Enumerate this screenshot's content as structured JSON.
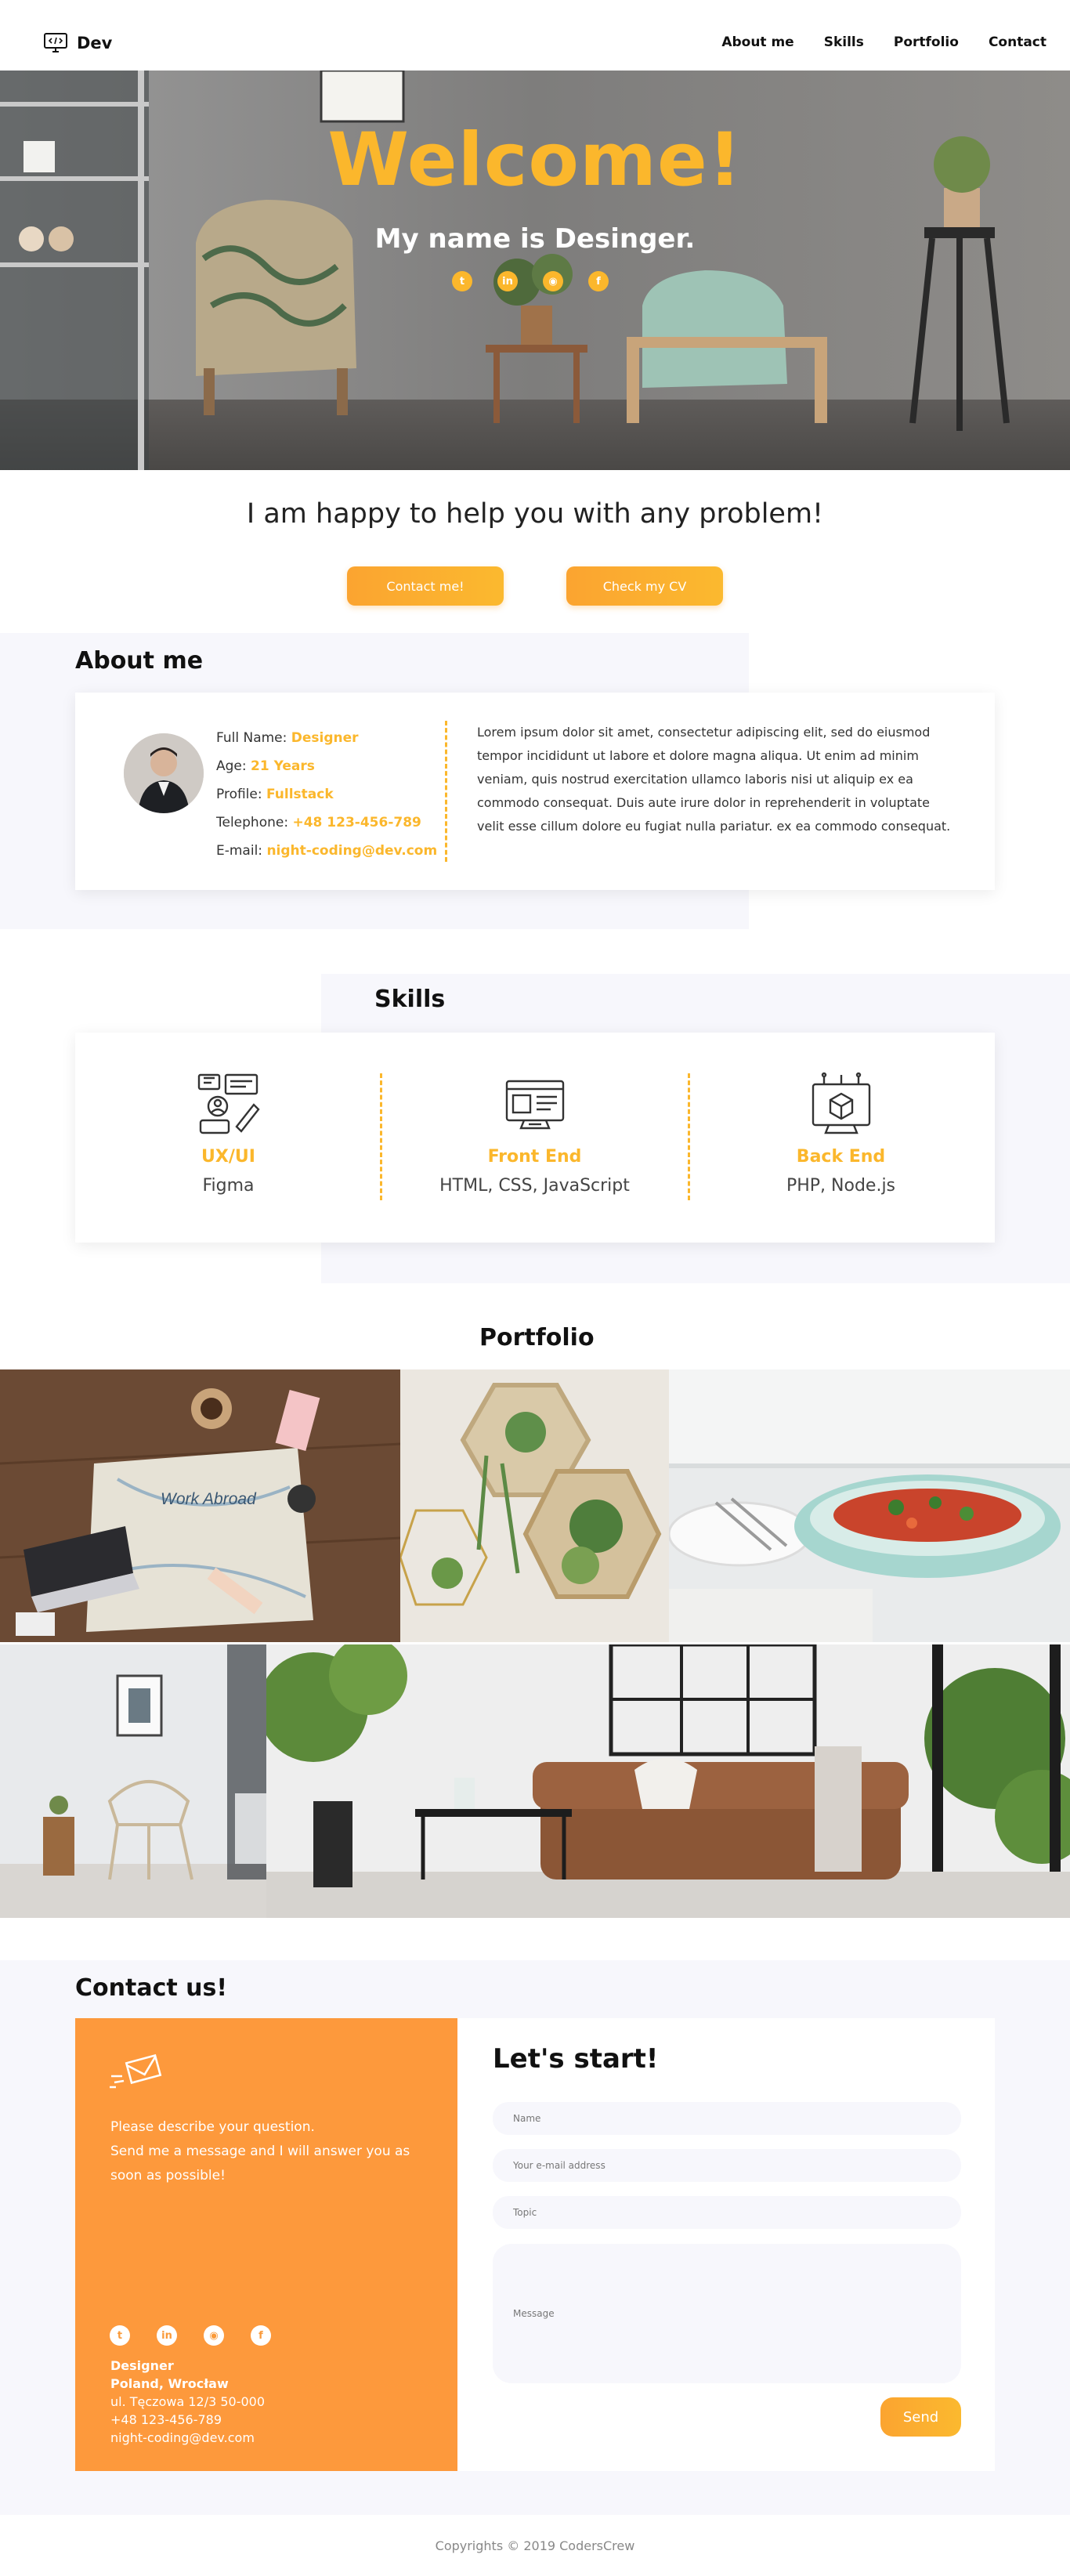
{
  "nav": {
    "logo_text": "Dev",
    "links": [
      "About me",
      "Skills",
      "Portfolio",
      "Contact"
    ]
  },
  "hero": {
    "title": "Welcome!",
    "subtitle": "My name is Desinger.",
    "social_icons": [
      "twitter-icon",
      "linkedin-icon",
      "github-icon",
      "facebook-icon"
    ]
  },
  "intro": {
    "tagline": "I am happy to help you with any problem!",
    "contact_button": "Contact me!",
    "cv_button": "Check my CV"
  },
  "about": {
    "title": "About me",
    "fields": [
      {
        "label": "Full Name: ",
        "value": "Designer"
      },
      {
        "label": "Age: ",
        "value": "21 Years"
      },
      {
        "label": "Profile: ",
        "value": "Fullstack"
      },
      {
        "label": "Telephone: ",
        "value": "+48 123-456-789"
      },
      {
        "label": "E-mail: ",
        "value": "night-coding@dev.com"
      }
    ],
    "text": "Lorem ipsum dolor sit amet, consectetur adipiscing elit, sed do eiusmod tempor incididunt ut labore et dolore magna aliqua. Ut enim ad minim veniam, quis nostrud exercitation ullamco laboris nisi ut aliquip ex ea commodo consequat. Duis aute irure dolor in reprehenderit in voluptate velit esse cillum dolore eu fugiat nulla pariatur. ex ea commodo consequat."
  },
  "skills": {
    "title": "Skills",
    "items": [
      {
        "name": "UX/UI",
        "tech": "Figma"
      },
      {
        "name": "Front End",
        "tech": "HTML, CSS, JavaScript"
      },
      {
        "name": "Back End",
        "tech": "PHP, Node.js"
      }
    ]
  },
  "portfolio": {
    "title": "Portfolio",
    "tile_caption": "Work Abroad"
  },
  "contact": {
    "title": "Contact us!",
    "text_line1": "Please describe your question.",
    "text_line2": "Send me a message and I will answer you as soon as possible!",
    "info": {
      "name": "Designer",
      "location": "Poland, Wrocław",
      "street": "ul. Tęczowa 12/3 50-000",
      "phone": "+48 123-456-789",
      "email": "night-coding@dev.com"
    },
    "form": {
      "title": "Let's start!",
      "name_placeholder": "Name",
      "email_placeholder": "Your e-mail address",
      "topic_placeholder": "Topic",
      "message_placeholder": "Message",
      "send_label": "Send"
    }
  },
  "footer": {
    "copyright": "Copyrights © 2019 CodersCrew"
  },
  "colors": {
    "accent": "#fbb72c",
    "orange": "#fd993c",
    "light_bg": "#f7f7fc"
  }
}
